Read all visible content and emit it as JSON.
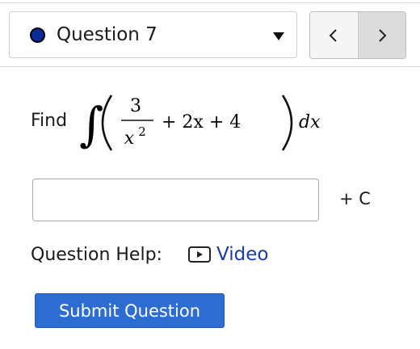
{
  "question_selector": {
    "label": "Question 7",
    "status_color": "#0b2a99"
  },
  "nav": {
    "prev_icon": "chevron-left-icon",
    "next_icon": "chevron-right-icon"
  },
  "problem": {
    "find_text": "Find",
    "integral_sign": "∫",
    "numerator": "3",
    "denominator_base": "x",
    "denominator_exponent": "2",
    "rest_terms": "+ 2x + 4",
    "differential": "dx"
  },
  "answer": {
    "value": "",
    "placeholder": "",
    "constant_label": "+ C"
  },
  "help": {
    "label": "Question Help:",
    "video_icon": "play-video-icon",
    "video_label": "Video"
  },
  "submit": {
    "label": "Submit Question",
    "color": "#2d6dd1"
  }
}
